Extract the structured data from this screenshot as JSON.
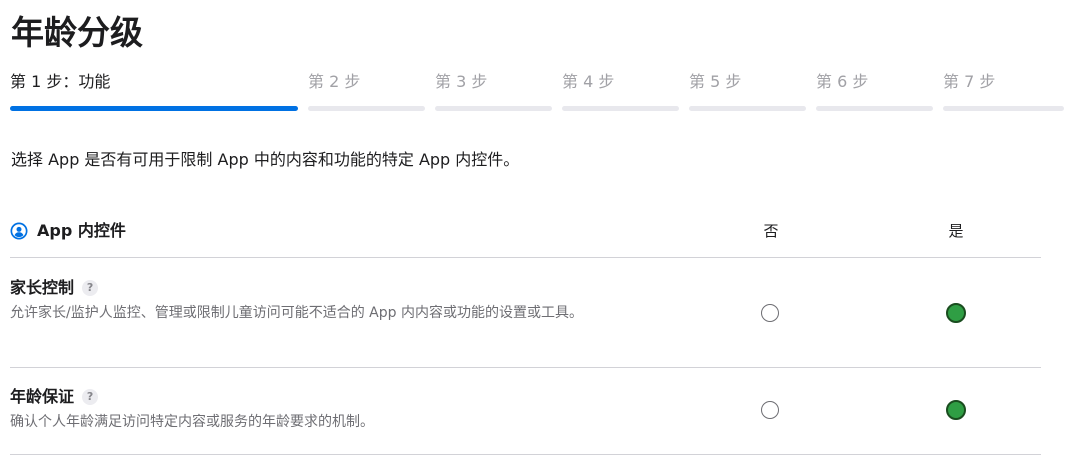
{
  "page": {
    "title": "年龄分级"
  },
  "steps": [
    {
      "label": "第 1 步：功能",
      "active": true
    },
    {
      "label": "第 2 步",
      "active": false
    },
    {
      "label": "第 3 步",
      "active": false
    },
    {
      "label": "第 4 步",
      "active": false
    },
    {
      "label": "第 5 步",
      "active": false
    },
    {
      "label": "第 6 步",
      "active": false
    },
    {
      "label": "第 7 步",
      "active": false
    }
  ],
  "intro": "选择 App 是否有可用于限制 App 中的内容和功能的特定 App 内控件。",
  "section": {
    "icon": "person-circle-icon",
    "title": "App 内控件",
    "col_no": "否",
    "col_yes": "是"
  },
  "colors": {
    "accent": "#0071e3",
    "selected": "#2f9e44"
  },
  "rows": [
    {
      "title": "家长控制",
      "help": "?",
      "description": "允许家长/监护人监控、管理或限制儿童访问可能不适合的 App 内内容或功能的设置或工具。",
      "selected": "是"
    },
    {
      "title": "年龄保证",
      "help": "?",
      "description": "确认个人年龄满足访问特定内容或服务的年龄要求的机制。",
      "selected": "是"
    }
  ]
}
